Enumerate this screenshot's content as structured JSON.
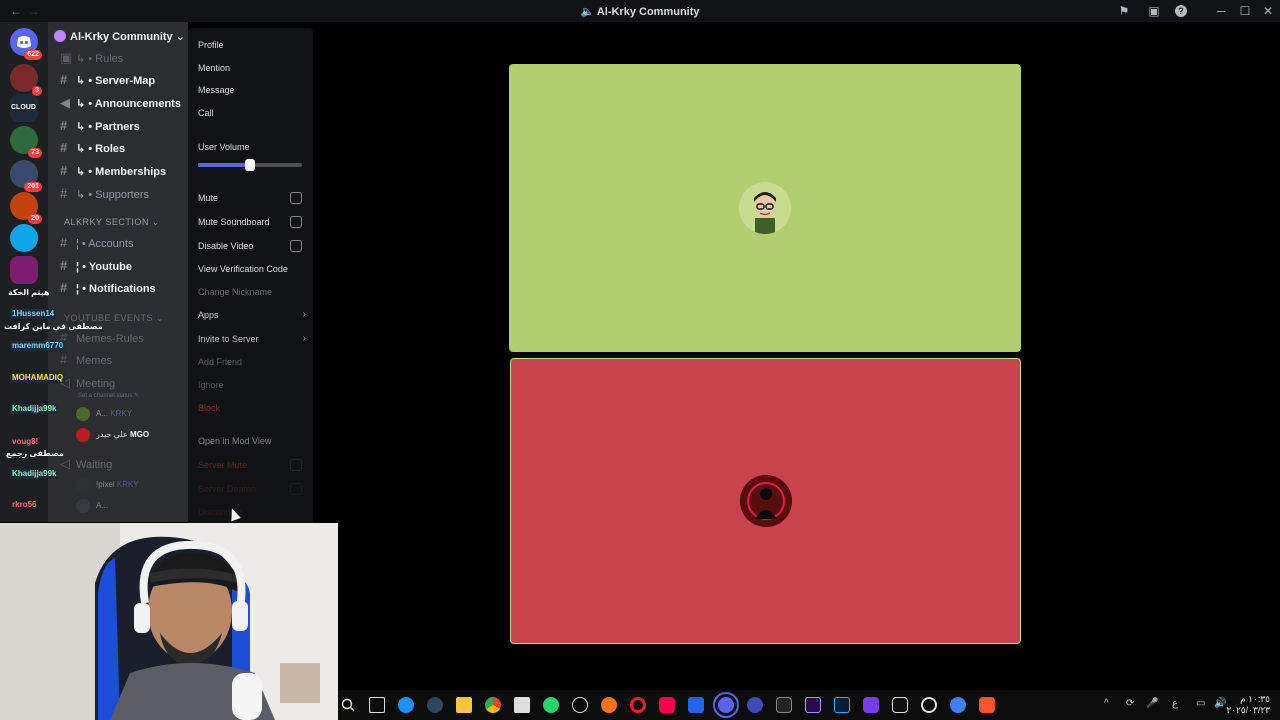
{
  "titlebar": {
    "back": "←",
    "forward": "→",
    "title": "Al-Krky Community",
    "icons": [
      "inbox-icon",
      "screen-icon",
      "help-icon",
      "minimize-icon",
      "maximize-icon",
      "close-icon"
    ],
    "icon_glyphs": [
      "⚑",
      "▣",
      "?",
      "─",
      "☐",
      "✕"
    ]
  },
  "servers": {
    "badges": [
      "622",
      "3",
      "73",
      "201",
      "20"
    ]
  },
  "guild": {
    "name": "Al-Krky Community",
    "chevron": "⌄"
  },
  "channels": {
    "items": [
      {
        "label": "↳ • Rules"
      },
      {
        "label": "↳ • Server-Map"
      },
      {
        "label": "↳ • Announcements"
      },
      {
        "label": "↳ • Partners"
      },
      {
        "label": "↳ • Roles"
      },
      {
        "label": "↳ • Memberships"
      },
      {
        "label": "↳ • Supporters"
      },
      {
        "label": "ALKRKY SECTION ⌄"
      },
      {
        "label": "¦ • Accounts"
      },
      {
        "label": "¦ • Youtube"
      },
      {
        "label": "¦ • Notifications"
      },
      {
        "label": "YOUTUBE EVENTS ⌄"
      },
      {
        "label": "Memes-Rules"
      },
      {
        "label": "Memes"
      },
      {
        "label": "Meeting"
      },
      {
        "label": "Set a channel status ✎"
      },
      {
        "label": "Waiting"
      }
    ],
    "voice_users": [
      {
        "name": "A...",
        "tag": "KRKY"
      },
      {
        "name": "علي حيدر",
        "tag": "MGO"
      },
      {
        "name": "!pixel",
        "tag": "KRKY"
      },
      {
        "name": "A...",
        "tag": ""
      }
    ]
  },
  "overlay_names": [
    "هيثم الحكة",
    "1Hussen14",
    "مصطفى في ماين كرافت",
    "maremm6770",
    "MOHAMADIQ",
    "Khadijja99k",
    "voug8!",
    "مصطفى رجمع",
    "Khadijja99k",
    "rkro56"
  ],
  "context_menu": {
    "profile": "Profile",
    "mention": "Mention",
    "message": "Message",
    "call": "Call",
    "user_volume": "User Volume",
    "volume_level": 0.5,
    "mute": "Mute",
    "mute_soundboard": "Mute Soundboard",
    "disable_video": "Disable Video",
    "view_verification_code": "View Verification Code",
    "change_nickname": "Change Nickname",
    "apps": "Apps",
    "invite_to_server": "Invite to Server",
    "add_friend": "Add Friend",
    "ignore": "Ignore",
    "block": "Block",
    "open_in_mod_view": "Open in Mod View",
    "server_mute": "Server Mute",
    "server_deafen": "Server Deafen",
    "disconnect": "Disconnect",
    "chevron": "›"
  },
  "tiles": {
    "top_color": "#b1cf6f",
    "bottom_color": "#c8434c"
  },
  "taskbar": {
    "tray_icons": [
      "^",
      "⟳",
      "🎤",
      "ع",
      "▭",
      "🔊"
    ],
    "clock_time": "١٠:٣٥ م",
    "clock_date": "٢٠٢٥/٠٣/٢٣"
  },
  "colors": {
    "accent": "#5865f2",
    "danger": "#f23f43"
  }
}
